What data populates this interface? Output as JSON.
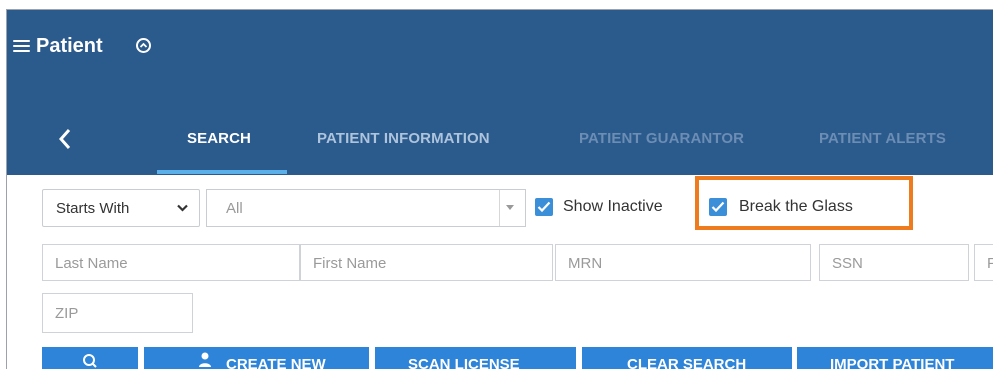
{
  "header": {
    "title": "Patient",
    "background": "#2b5a8c",
    "icons": [
      "menu-icon",
      "chevron-up-circle-icon",
      "back-chevron-icon"
    ]
  },
  "tabs": [
    {
      "label": "SEARCH",
      "active": true
    },
    {
      "label": "PATIENT INFORMATION",
      "active": false
    },
    {
      "label": "PATIENT GUARANTOR",
      "active": false
    },
    {
      "label": "PATIENT ALERTS",
      "active": false
    }
  ],
  "filters": {
    "match_mode": "Starts With",
    "scope": "All",
    "show_inactive": {
      "label": "Show Inactive",
      "checked": true
    },
    "break_the_glass": {
      "label": "Break the Glass",
      "checked": true
    }
  },
  "search_fields": {
    "last_name": "Last Name",
    "first_name": "First Name",
    "mrn": "MRN",
    "ssn": "SSN",
    "partial": "P",
    "zip": "ZIP"
  },
  "buttons": {
    "create_new": "CREATE NEW",
    "scan_license": "SCAN LICENSE",
    "clear_search": "CLEAR SEARCH",
    "import_patient": "IMPORT PATIENT"
  },
  "colors": {
    "accent": "#2e84d8",
    "checkbox": "#3b8fd8",
    "highlight": "#ee7b1e",
    "active_tab_underline": "#5cb0ea"
  }
}
